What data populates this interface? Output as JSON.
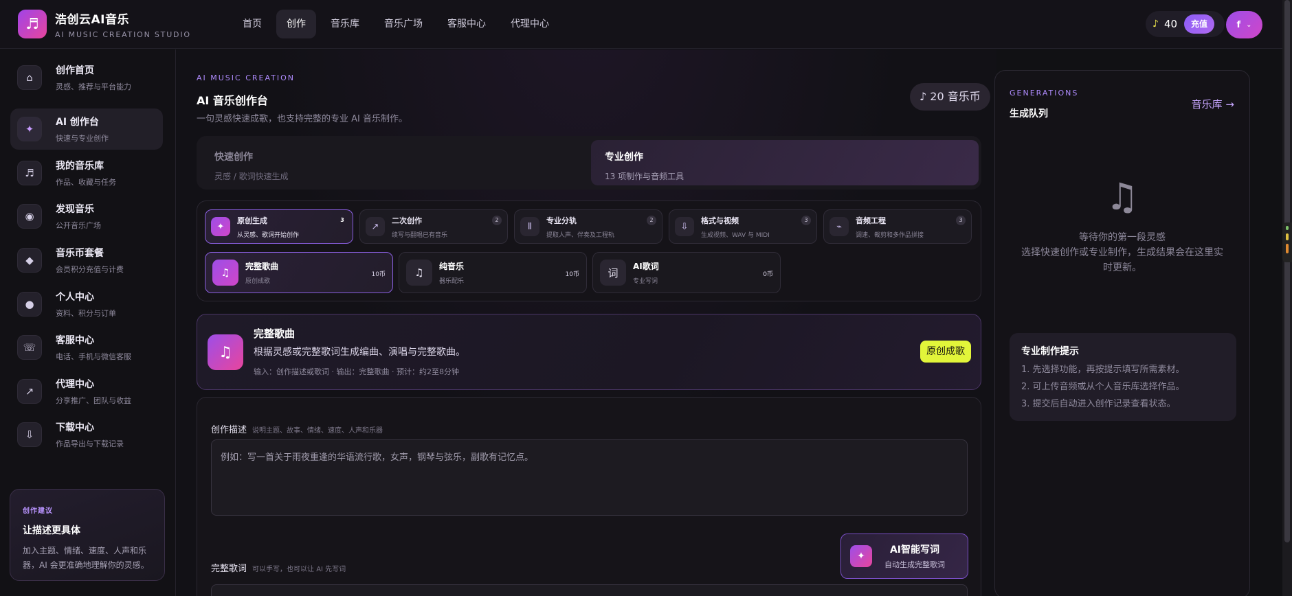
{
  "header": {
    "brand_name": "浩创云AI音乐",
    "brand_sub": "AI MUSIC CREATION STUDIO",
    "nav": [
      "首页",
      "创作",
      "音乐库",
      "音乐广场",
      "客服中心",
      "代理中心"
    ],
    "credits": "40",
    "recharge": "充值",
    "avatar_initial": "f"
  },
  "sidebar": {
    "items": [
      {
        "title": "创作首页",
        "sub": "灵感、推荐与平台能力",
        "icon": "⌂"
      },
      {
        "title": "AI 创作台",
        "sub": "快速与专业创作",
        "icon": "✦"
      },
      {
        "title": "我的音乐库",
        "sub": "作品、收藏与任务",
        "icon": "♬"
      },
      {
        "title": "发现音乐",
        "sub": "公开音乐广场",
        "icon": "◉"
      },
      {
        "title": "音乐币套餐",
        "sub": "会员积分充值与计费",
        "icon": "◆"
      },
      {
        "title": "个人中心",
        "sub": "资料、积分与订单",
        "icon": "●"
      },
      {
        "title": "客服中心",
        "sub": "电话、手机与微信客服",
        "icon": "☏"
      },
      {
        "title": "代理中心",
        "sub": "分享推广、团队与收益",
        "icon": "↗"
      },
      {
        "title": "下载中心",
        "sub": "作品导出与下载记录",
        "icon": "⇩"
      }
    ],
    "tip": {
      "label": "创作建议",
      "title": "让描述更具体",
      "body": "加入主题、情绪、速度、人声和乐器，AI 会更准确地理解你的灵感。"
    }
  },
  "main": {
    "eyebrow": "AI MUSIC CREATION",
    "title": "AI 音乐创作台",
    "desc": "一句灵感快速成歌，也支持完整的专业 AI 音乐制作。",
    "coin_balance": "♪ 20 音乐币",
    "modes": [
      {
        "title": "快速创作",
        "sub": "灵感 / 歌词快速生成"
      },
      {
        "title": "专业创作",
        "sub": "13 项制作与音频工具"
      }
    ],
    "categories": [
      {
        "title": "原创生成",
        "sub": "从灵感、歌词开始创作",
        "count": "3",
        "icon": "✦"
      },
      {
        "title": "二次创作",
        "sub": "续写与翻唱已有音乐",
        "count": "2",
        "icon": "↗"
      },
      {
        "title": "专业分轨",
        "sub": "提取人声、伴奏及工程轨",
        "count": "2",
        "icon": "Ⅱ"
      },
      {
        "title": "格式与视频",
        "sub": "生成视频、WAV 与 MIDI",
        "count": "3",
        "icon": "⇩"
      },
      {
        "title": "音频工程",
        "sub": "调速、裁剪和多作品拼接",
        "count": "3",
        "icon": "⌁"
      }
    ],
    "subfunctions": [
      {
        "title": "完整歌曲",
        "desc": "原创成歌",
        "price": "10币",
        "icon": "♫"
      },
      {
        "title": "纯音乐",
        "desc": "器乐配乐",
        "price": "10币",
        "icon": "♫"
      },
      {
        "title": "AI歌词",
        "desc": "专业写词",
        "price": "0币",
        "icon": "词"
      }
    ],
    "detail": {
      "title": "完整歌曲",
      "desc": "根据灵感或完整歌词生成编曲、演唱与完整歌曲。",
      "meta": "输入：创作描述或歌词   ·   输出：完整歌曲   ·   预计：约2至8分钟",
      "tag": "原创成歌"
    },
    "form": {
      "desc_label": "创作描述",
      "desc_hint": "说明主题、故事、情绪、速度、人声和乐器",
      "desc_placeholder": "例如：写一首关于雨夜重逢的华语流行歌，女声，钢琴与弦乐，副歌有记忆点。",
      "lyrics_label": "完整歌词",
      "lyrics_hint": "可以手写，也可以让 AI 先写词",
      "ai_btn_title": "AI智能写词",
      "ai_btn_sub": "自动生成完整歌词"
    }
  },
  "right": {
    "eyebrow": "GENERATIONS",
    "title": "生成队列",
    "link": "音乐库 →",
    "empty_title": "等待你的第一段灵感",
    "empty_desc": "选择快速创作或专业制作，生成结果会在这里实时更新。",
    "tips_title": "专业制作提示",
    "tips": [
      "1. 先选择功能，再按提示填写所需素材。",
      "2. 可上传音频或从个人音乐库选择作品。",
      "3. 提交后自动进入创作记录查看状态。"
    ]
  }
}
